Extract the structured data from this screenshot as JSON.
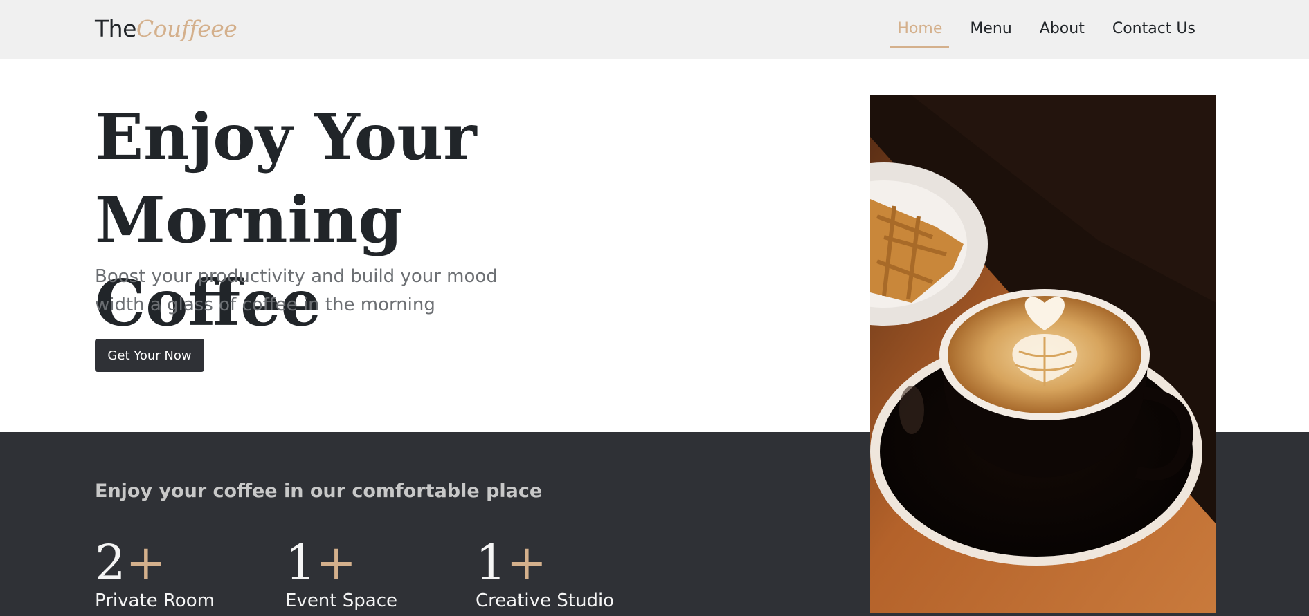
{
  "brand": {
    "prefix": "The",
    "accent": "Couffeee"
  },
  "nav": {
    "items": [
      {
        "label": "Home",
        "active": true
      },
      {
        "label": "Menu",
        "active": false
      },
      {
        "label": "About",
        "active": false
      },
      {
        "label": "Contact Us",
        "active": false
      }
    ]
  },
  "hero": {
    "title_line1": "Enjoy Your",
    "title_line2": "Morning Coffee",
    "subtitle_line1": "Boost your productivity and build your mood",
    "subtitle_line2": "width a glass of coffee in the morning",
    "cta_label": "Get Your Now"
  },
  "section": {
    "heading": "Enjoy your coffee in our comfortable place",
    "stats": [
      {
        "number": "2",
        "suffix": "+",
        "label": "Private Room"
      },
      {
        "number": "1",
        "suffix": "+",
        "label": "Event Space"
      },
      {
        "number": "1",
        "suffix": "+",
        "label": "Creative Studio"
      }
    ]
  },
  "colors": {
    "accent": "#d4b08c",
    "dark": "#2f3136",
    "navbar_bg": "#f0f0f0"
  }
}
